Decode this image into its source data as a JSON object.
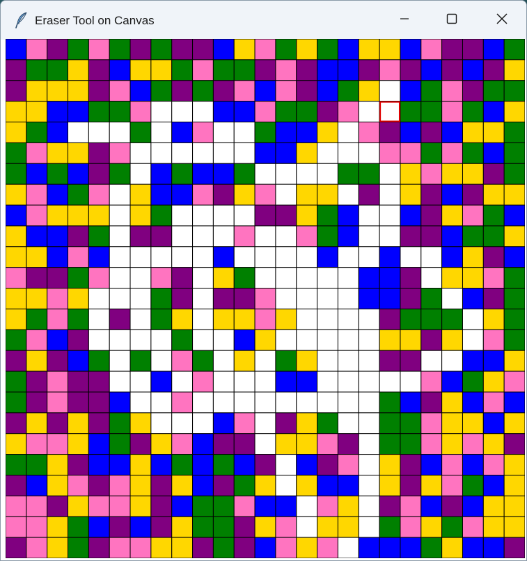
{
  "window": {
    "title": "Eraser Tool on Canvas"
  },
  "icons": {
    "app": "feather-icon",
    "minimize": "minimize-icon",
    "maximize": "maximize-icon",
    "close": "close-icon"
  },
  "canvas": {
    "rows": 25,
    "cols": 25,
    "palette": {
      "B": "#0000ff",
      "P": "#ff74c0",
      "U": "#800080",
      "G": "#008000",
      "Y": "#ffd700",
      "W": "#ffffff"
    },
    "grid_line_color": "#000000",
    "highlight_color": "#e00000",
    "highlight_cell": {
      "row": 3,
      "col": 18
    },
    "cells": [
      "BPUGPGUGUUBYPGYGBYYBPUUBG",
      "UGGYUBYYGPGGUPUBBUPUBUBUY",
      "UYYYUPBGUGUPBPUBGYWBGPUGG",
      "YYBBGGPWWWBBPGGUPWWGGPGBY",
      "YGBWWWGWBPWWGBBYWPUBUBYYG",
      "GPYYUPWWWWWWBBYWWWPPGPGBG",
      "GBGBUGWBGBBGWWWWGGWYPYYUG",
      "YPBGPWYBBPUYPWYYWUWYUBUYY",
      "BPYYYWYGWWWWUUYGBWWBUYPGB",
      "YBBUGWUUWWWPWWPGBWWUUBGGY",
      "YYBPBWWWWWBWWWWBWWBWWBYUB",
      "PUUGPWWPUWYGWWWWWBBUWYYPG",
      "YYPYWWWGUWUUPWWWWBBUGWBUG",
      "YGPGWUWGYWYYPYWWWWUGGGWYG",
      "GPBUWWWWGWWBYWWWWWYYUYWPG",
      "UYUBGWGWPGWYWGYWWWUUWWBBY",
      "GUPUUWWBWPWWWBBWWWWWPBGYP",
      "GUPUUBWWPWWWWWWWWWGBUYBPB",
      "UYUYUGYWWWBPWUYGWWGGPYYBY",
      "YPPYBGUYPBUUWYYPUWGGPYPYU",
      "GGYUBBYBGBGBUWBUPWYUBPBPY",
      "UBYPUPYUYBUGYWYBBWYUYPGBY",
      "PPUYPPYUBGGPBBWPYWUPBUBYY",
      "PPYGBUBUYGGUYPWYYWGPYGPYY",
      "UPYGUPPYYUGUBPYPWBBBGYBBU"
    ]
  }
}
